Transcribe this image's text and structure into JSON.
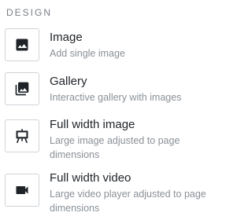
{
  "section": {
    "title": "DESIGN"
  },
  "items": [
    {
      "label": "Image",
      "description": "Add single image",
      "icon": "image-icon"
    },
    {
      "label": "Gallery",
      "description": "Interactive gallery with images",
      "icon": "gallery-icon"
    },
    {
      "label": "Full width image",
      "description": "Large image adjusted to page dimensions",
      "icon": "easel-icon"
    },
    {
      "label": "Full width video",
      "description": "Large video player adjusted to page dimensions",
      "icon": "video-camera-icon"
    }
  ]
}
